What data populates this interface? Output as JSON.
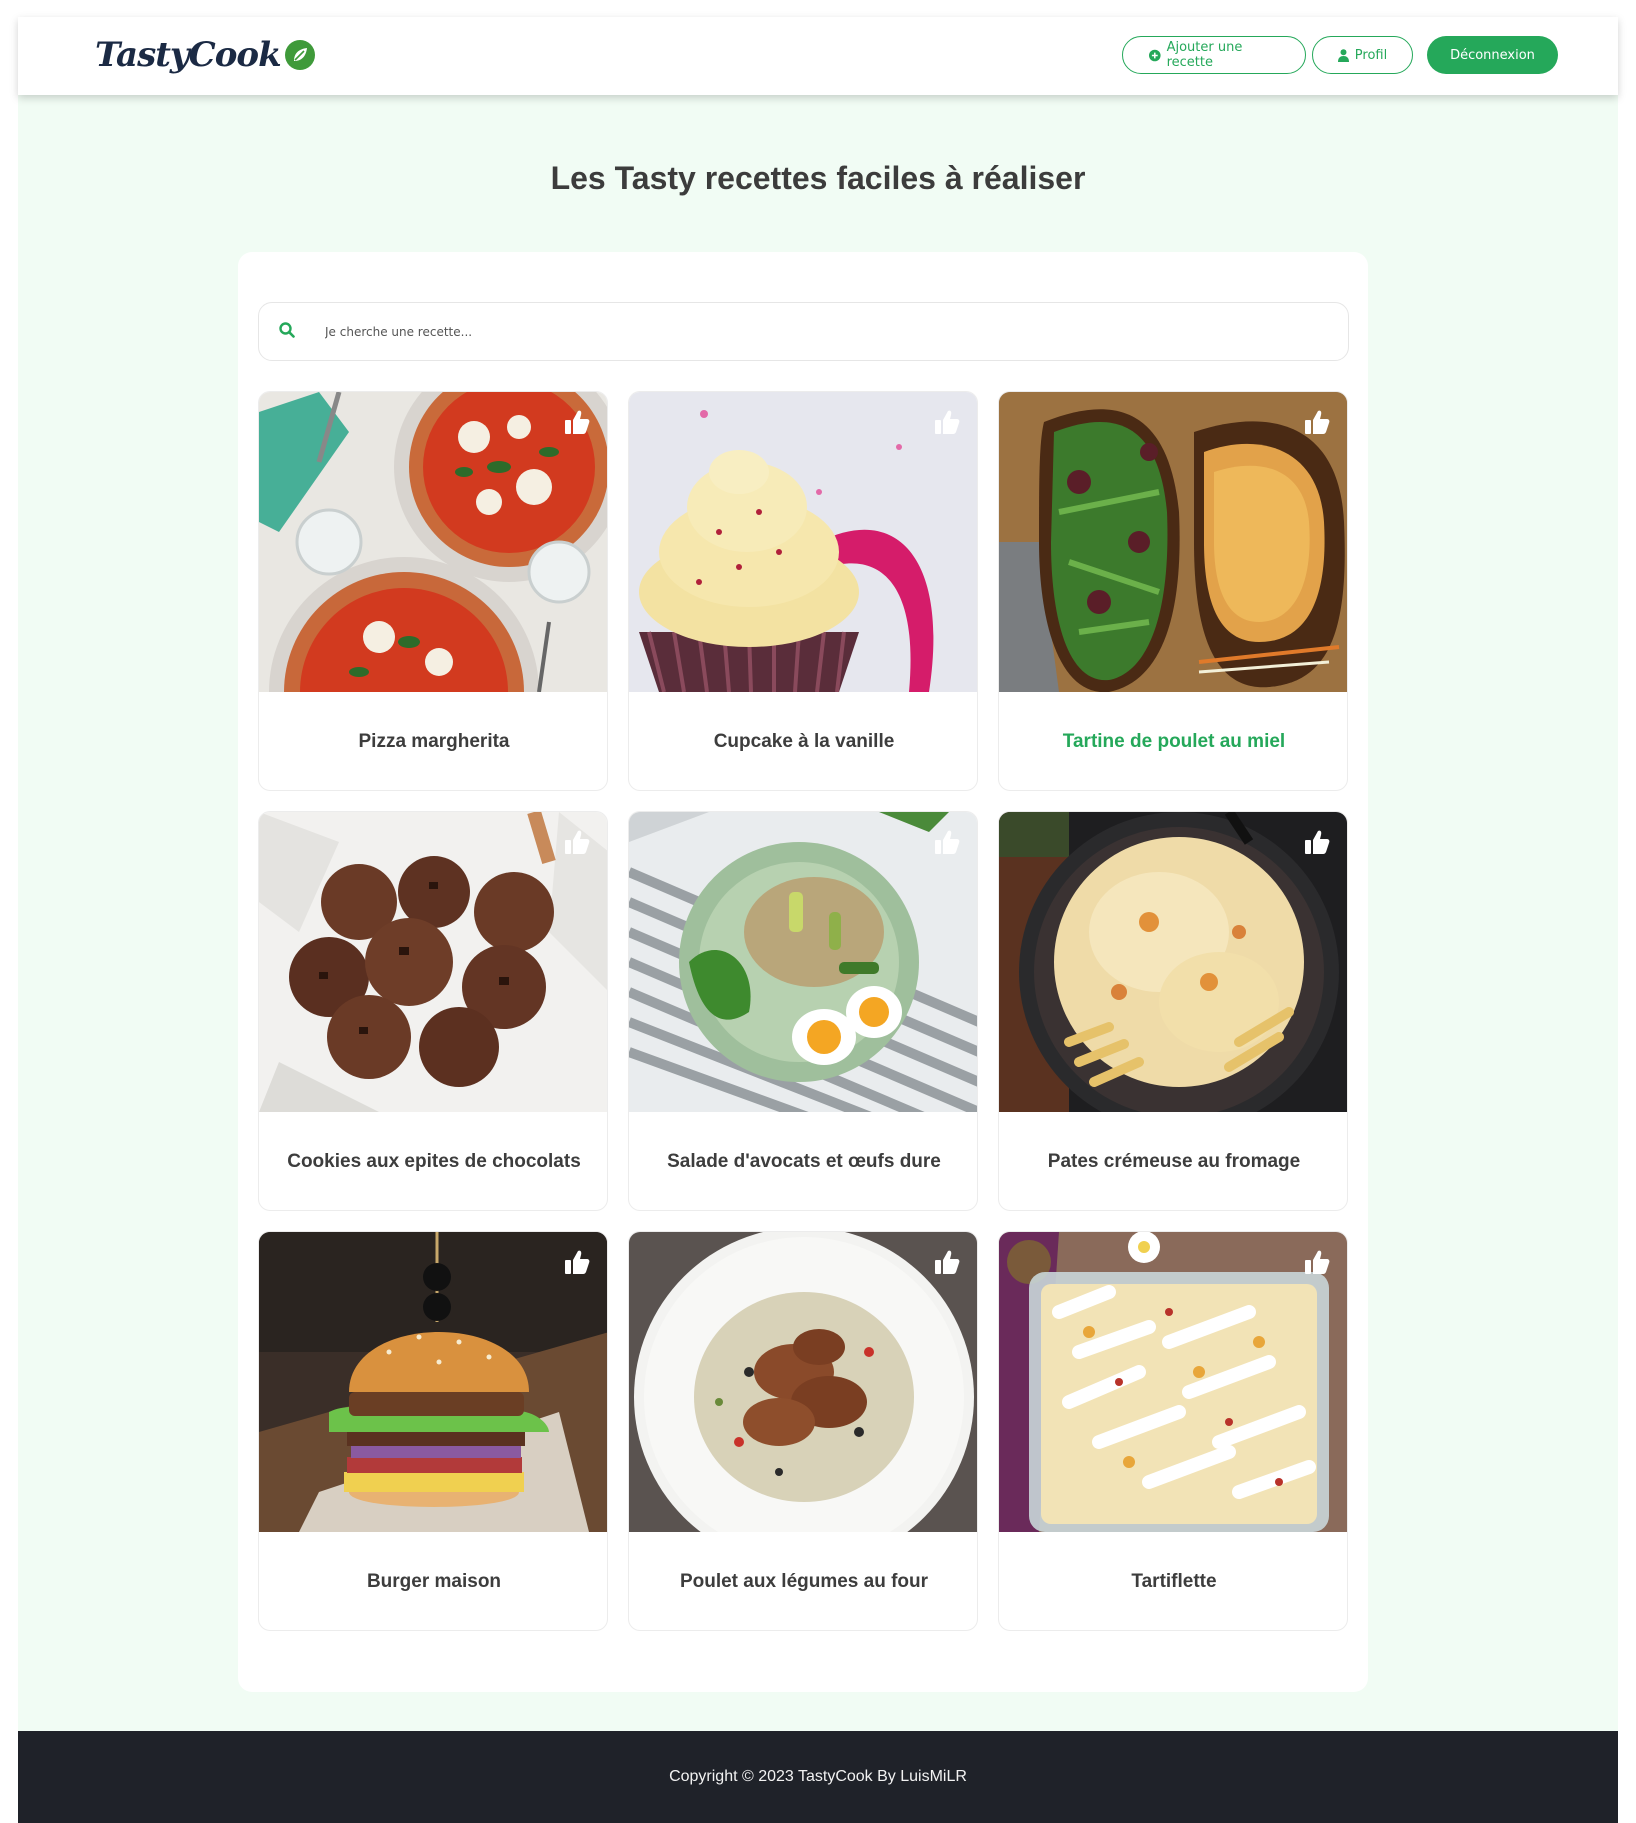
{
  "brand": {
    "logo_text": "TastyCook"
  },
  "nav": {
    "add_recipe": "Ajouter une recette",
    "profile": "Profil",
    "logout": "Déconnexion"
  },
  "main": {
    "title": "Les Tasty recettes faciles à réaliser",
    "search_placeholder": "Je cherche une recette..."
  },
  "recipes": [
    {
      "title": "Pizza margherita",
      "highlighted": false
    },
    {
      "title": "Cupcake à la vanille",
      "highlighted": false
    },
    {
      "title": "Tartine de poulet au miel",
      "highlighted": true
    },
    {
      "title": "Cookies aux epites de chocolats",
      "highlighted": false
    },
    {
      "title": "Salade d'avocats et œufs dure",
      "highlighted": false
    },
    {
      "title": "Pates crémeuse au fromage",
      "highlighted": false
    },
    {
      "title": "Burger maison",
      "highlighted": false
    },
    {
      "title": "Poulet aux légumes au four",
      "highlighted": false
    },
    {
      "title": "Tartiflette",
      "highlighted": false
    }
  ],
  "footer": {
    "copyright": "Copyright © 2023 TastyCook By LuisMiLR"
  },
  "colors": {
    "accent": "#25a85a",
    "page_bg": "#f1fcf4",
    "footer_bg": "#1f2229"
  }
}
